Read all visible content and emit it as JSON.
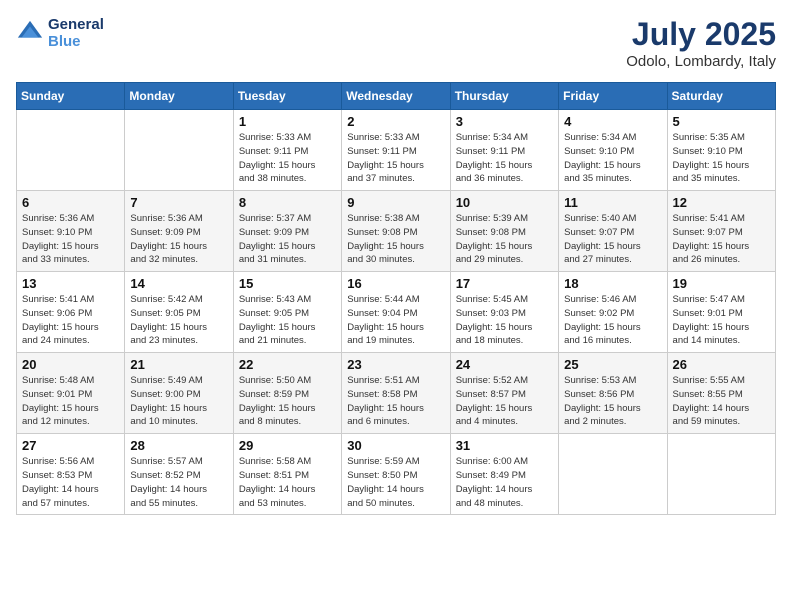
{
  "header": {
    "logo_line1": "General",
    "logo_line2": "Blue",
    "month_year": "July 2025",
    "location": "Odolo, Lombardy, Italy"
  },
  "weekdays": [
    "Sunday",
    "Monday",
    "Tuesday",
    "Wednesday",
    "Thursday",
    "Friday",
    "Saturday"
  ],
  "weeks": [
    [
      {
        "day": "",
        "detail": ""
      },
      {
        "day": "",
        "detail": ""
      },
      {
        "day": "1",
        "detail": "Sunrise: 5:33 AM\nSunset: 9:11 PM\nDaylight: 15 hours\nand 38 minutes."
      },
      {
        "day": "2",
        "detail": "Sunrise: 5:33 AM\nSunset: 9:11 PM\nDaylight: 15 hours\nand 37 minutes."
      },
      {
        "day": "3",
        "detail": "Sunrise: 5:34 AM\nSunset: 9:11 PM\nDaylight: 15 hours\nand 36 minutes."
      },
      {
        "day": "4",
        "detail": "Sunrise: 5:34 AM\nSunset: 9:10 PM\nDaylight: 15 hours\nand 35 minutes."
      },
      {
        "day": "5",
        "detail": "Sunrise: 5:35 AM\nSunset: 9:10 PM\nDaylight: 15 hours\nand 35 minutes."
      }
    ],
    [
      {
        "day": "6",
        "detail": "Sunrise: 5:36 AM\nSunset: 9:10 PM\nDaylight: 15 hours\nand 33 minutes."
      },
      {
        "day": "7",
        "detail": "Sunrise: 5:36 AM\nSunset: 9:09 PM\nDaylight: 15 hours\nand 32 minutes."
      },
      {
        "day": "8",
        "detail": "Sunrise: 5:37 AM\nSunset: 9:09 PM\nDaylight: 15 hours\nand 31 minutes."
      },
      {
        "day": "9",
        "detail": "Sunrise: 5:38 AM\nSunset: 9:08 PM\nDaylight: 15 hours\nand 30 minutes."
      },
      {
        "day": "10",
        "detail": "Sunrise: 5:39 AM\nSunset: 9:08 PM\nDaylight: 15 hours\nand 29 minutes."
      },
      {
        "day": "11",
        "detail": "Sunrise: 5:40 AM\nSunset: 9:07 PM\nDaylight: 15 hours\nand 27 minutes."
      },
      {
        "day": "12",
        "detail": "Sunrise: 5:41 AM\nSunset: 9:07 PM\nDaylight: 15 hours\nand 26 minutes."
      }
    ],
    [
      {
        "day": "13",
        "detail": "Sunrise: 5:41 AM\nSunset: 9:06 PM\nDaylight: 15 hours\nand 24 minutes."
      },
      {
        "day": "14",
        "detail": "Sunrise: 5:42 AM\nSunset: 9:05 PM\nDaylight: 15 hours\nand 23 minutes."
      },
      {
        "day": "15",
        "detail": "Sunrise: 5:43 AM\nSunset: 9:05 PM\nDaylight: 15 hours\nand 21 minutes."
      },
      {
        "day": "16",
        "detail": "Sunrise: 5:44 AM\nSunset: 9:04 PM\nDaylight: 15 hours\nand 19 minutes."
      },
      {
        "day": "17",
        "detail": "Sunrise: 5:45 AM\nSunset: 9:03 PM\nDaylight: 15 hours\nand 18 minutes."
      },
      {
        "day": "18",
        "detail": "Sunrise: 5:46 AM\nSunset: 9:02 PM\nDaylight: 15 hours\nand 16 minutes."
      },
      {
        "day": "19",
        "detail": "Sunrise: 5:47 AM\nSunset: 9:01 PM\nDaylight: 15 hours\nand 14 minutes."
      }
    ],
    [
      {
        "day": "20",
        "detail": "Sunrise: 5:48 AM\nSunset: 9:01 PM\nDaylight: 15 hours\nand 12 minutes."
      },
      {
        "day": "21",
        "detail": "Sunrise: 5:49 AM\nSunset: 9:00 PM\nDaylight: 15 hours\nand 10 minutes."
      },
      {
        "day": "22",
        "detail": "Sunrise: 5:50 AM\nSunset: 8:59 PM\nDaylight: 15 hours\nand 8 minutes."
      },
      {
        "day": "23",
        "detail": "Sunrise: 5:51 AM\nSunset: 8:58 PM\nDaylight: 15 hours\nand 6 minutes."
      },
      {
        "day": "24",
        "detail": "Sunrise: 5:52 AM\nSunset: 8:57 PM\nDaylight: 15 hours\nand 4 minutes."
      },
      {
        "day": "25",
        "detail": "Sunrise: 5:53 AM\nSunset: 8:56 PM\nDaylight: 15 hours\nand 2 minutes."
      },
      {
        "day": "26",
        "detail": "Sunrise: 5:55 AM\nSunset: 8:55 PM\nDaylight: 14 hours\nand 59 minutes."
      }
    ],
    [
      {
        "day": "27",
        "detail": "Sunrise: 5:56 AM\nSunset: 8:53 PM\nDaylight: 14 hours\nand 57 minutes."
      },
      {
        "day": "28",
        "detail": "Sunrise: 5:57 AM\nSunset: 8:52 PM\nDaylight: 14 hours\nand 55 minutes."
      },
      {
        "day": "29",
        "detail": "Sunrise: 5:58 AM\nSunset: 8:51 PM\nDaylight: 14 hours\nand 53 minutes."
      },
      {
        "day": "30",
        "detail": "Sunrise: 5:59 AM\nSunset: 8:50 PM\nDaylight: 14 hours\nand 50 minutes."
      },
      {
        "day": "31",
        "detail": "Sunrise: 6:00 AM\nSunset: 8:49 PM\nDaylight: 14 hours\nand 48 minutes."
      },
      {
        "day": "",
        "detail": ""
      },
      {
        "day": "",
        "detail": ""
      }
    ]
  ]
}
